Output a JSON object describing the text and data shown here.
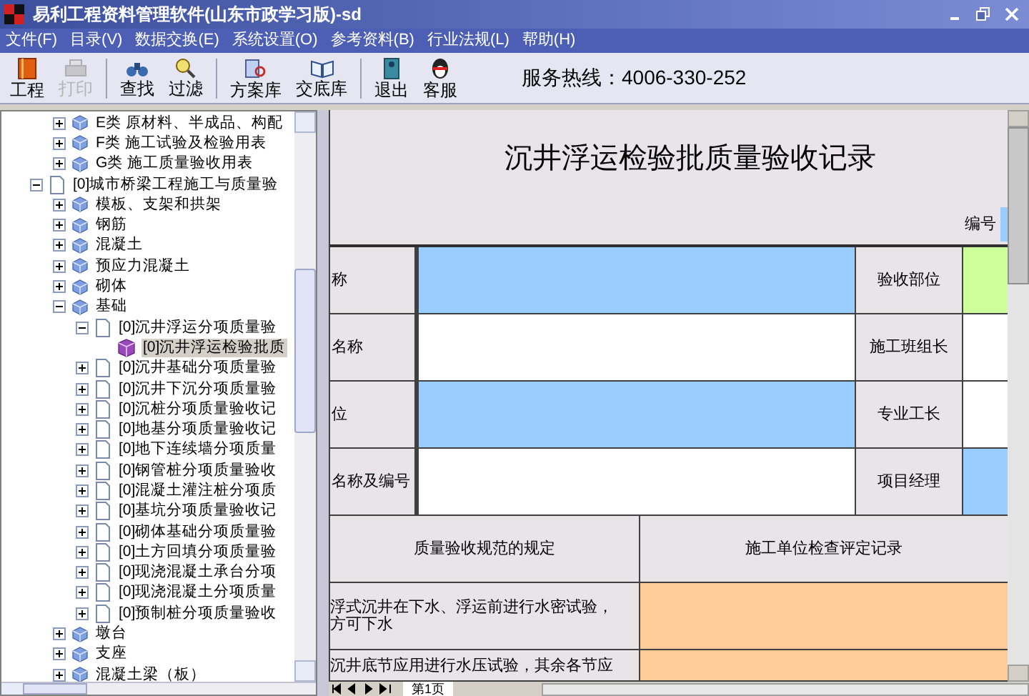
{
  "window": {
    "title": "易利工程资料管理软件(山东市政学习版)-sd"
  },
  "menu": [
    "文件(F)",
    "目录(V)",
    "数据交换(E)",
    "系统设置(O)",
    "参考资料(B)",
    "行业法规(L)",
    "帮助(H)"
  ],
  "toolbar": {
    "groups": [
      [
        {
          "label": "工程",
          "disabled": false
        },
        {
          "label": "打印",
          "disabled": true
        }
      ],
      [
        {
          "label": "查找",
          "disabled": false
        },
        {
          "label": "过滤",
          "disabled": false
        }
      ],
      [
        {
          "label": "方案库",
          "disabled": false
        },
        {
          "label": "交底库",
          "disabled": false
        }
      ],
      [
        {
          "label": "退出",
          "disabled": false
        },
        {
          "label": "客服",
          "disabled": false
        }
      ]
    ],
    "hotline": "服务热线：4006-330-252"
  },
  "tree": {
    "continued_items": [
      {
        "label": "E类 原材料、半成品、构配",
        "kind": "category",
        "expanded": false,
        "selected": false
      },
      {
        "label": "F类 施工试验及检验用表",
        "kind": "category",
        "expanded": false,
        "selected": false
      },
      {
        "label": "G类 施工质量验收用表",
        "kind": "category",
        "expanded": false,
        "selected": false
      }
    ],
    "items": [
      {
        "label": "[0]城市桥梁工程施工与质量验",
        "kind": "document",
        "expanded": true,
        "selected": false,
        "children": [
          {
            "label": "模板、支架和拱架",
            "kind": "category",
            "expanded": false,
            "selected": false
          },
          {
            "label": "钢筋",
            "kind": "category",
            "expanded": false,
            "selected": false
          },
          {
            "label": "混凝土",
            "kind": "category",
            "expanded": false,
            "selected": false
          },
          {
            "label": "预应力混凝土",
            "kind": "category",
            "expanded": false,
            "selected": false
          },
          {
            "label": "砌体",
            "kind": "category",
            "expanded": false,
            "selected": false
          },
          {
            "label": "基础",
            "kind": "category",
            "expanded": true,
            "selected": false,
            "children": [
              {
                "label": "[0]沉井浮运分项质量验",
                "kind": "document",
                "expanded": true,
                "selected": false,
                "children": [
                  {
                    "label": "[0]沉井浮运检验批质",
                    "kind": "record",
                    "selected": true
                  }
                ]
              },
              {
                "label": "[0]沉井基础分项质量验",
                "kind": "document",
                "expanded": false,
                "selected": false
              },
              {
                "label": "[0]沉井下沉分项质量验",
                "kind": "document",
                "expanded": false,
                "selected": false
              },
              {
                "label": "[0]沉桩分项质量验收记",
                "kind": "document",
                "expanded": false,
                "selected": false
              },
              {
                "label": "[0]地基分项质量验收记",
                "kind": "document",
                "expanded": false,
                "selected": false
              },
              {
                "label": "[0]地下连续墙分项质量",
                "kind": "document",
                "expanded": false,
                "selected": false
              },
              {
                "label": "[0]钢管桩分项质量验收",
                "kind": "document",
                "expanded": false,
                "selected": false
              },
              {
                "label": "[0]混凝土灌注桩分项质",
                "kind": "document",
                "expanded": false,
                "selected": false
              },
              {
                "label": "[0]基坑分项质量验收记",
                "kind": "document",
                "expanded": false,
                "selected": false
              },
              {
                "label": "[0]砌体基础分项质量验",
                "kind": "document",
                "expanded": false,
                "selected": false
              },
              {
                "label": "[0]土方回填分项质量验",
                "kind": "document",
                "expanded": false,
                "selected": false
              },
              {
                "label": "[0]现浇混凝土承台分项",
                "kind": "document",
                "expanded": false,
                "selected": false
              },
              {
                "label": "[0]现浇混凝土分项质量",
                "kind": "document",
                "expanded": false,
                "selected": false
              },
              {
                "label": "[0]预制桩分项质量验收",
                "kind": "document",
                "expanded": false,
                "selected": false
              }
            ]
          },
          {
            "label": "墩台",
            "kind": "category",
            "expanded": false,
            "selected": false
          },
          {
            "label": "支座",
            "kind": "category",
            "expanded": false,
            "selected": false
          },
          {
            "label": "混凝土梁（板）",
            "kind": "category",
            "expanded": false,
            "selected": false
          }
        ]
      }
    ]
  },
  "sheet": {
    "title": "沉井浮运检验批质量验收记录",
    "number_label": "编号",
    "info_rows": [
      {
        "label": "称",
        "value": {
          "color": "#99ccff"
        },
        "label_2": "验收部位",
        "value_2": {
          "color": "#ccff99"
        }
      },
      {
        "label": "名称",
        "value": {
          "color": "#ffffff"
        },
        "label_2": "施工班组长",
        "value_2": {
          "color": "#ffffff"
        }
      },
      {
        "label": "位",
        "value": {
          "color": "#99ccff"
        },
        "label_2": "专业工长",
        "value_2": {
          "color": "#ffffff"
        }
      },
      {
        "label": "名称及编号",
        "value": {
          "color": "#ffffff"
        },
        "label_2": "项目经理",
        "value_2": {
          "color": "#99ccff"
        }
      }
    ],
    "columns": [
      "质量验收规范的规定",
      "施工单位检查评定记录"
    ],
    "rows": [
      {
        "text": "浮式沉井在下水、浮运前进行水密试验，方可下水",
        "color": "#ffcc99"
      },
      {
        "text": "沉井底节应用进行水压试验，其余各节应",
        "color": "#ffcc99"
      }
    ],
    "tabs": [
      {
        "label": "第1页",
        "selected": true
      }
    ]
  }
}
